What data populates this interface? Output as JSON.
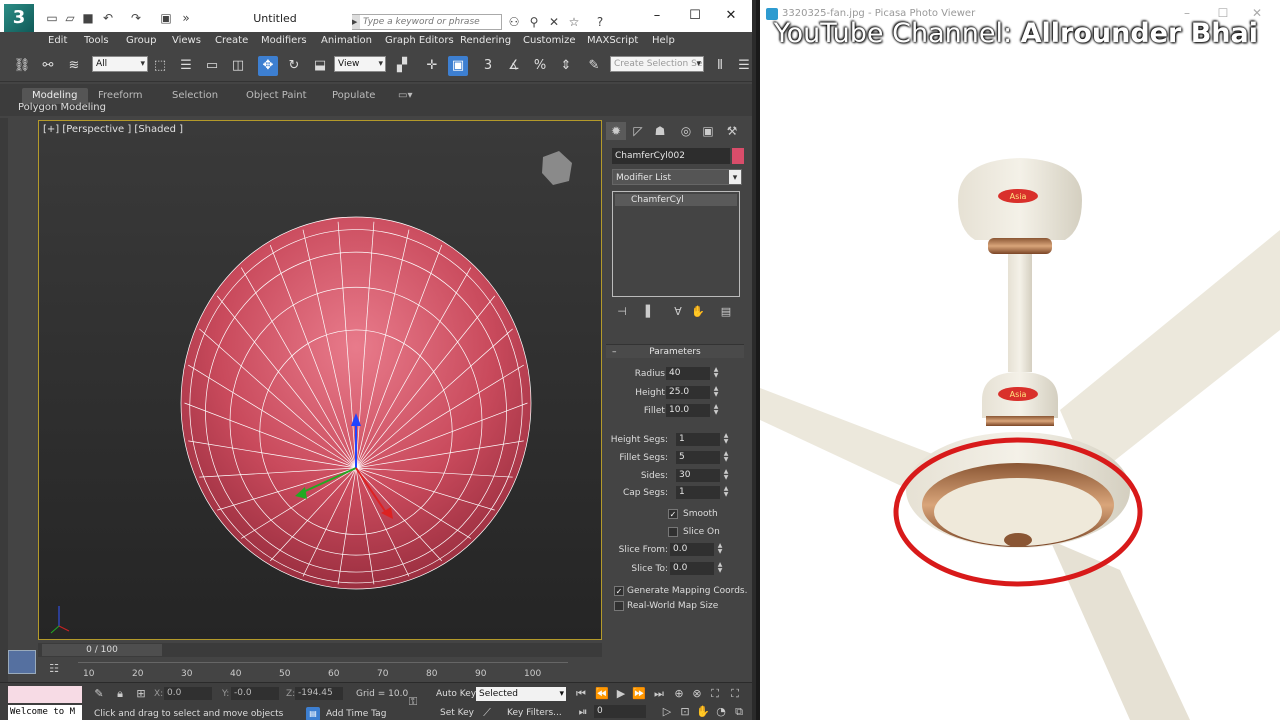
{
  "max": {
    "app_logo": "3",
    "doc_title": "Untitled",
    "search_placeholder": "Type a keyword or phrase",
    "menu": [
      "Edit",
      "Tools",
      "Group",
      "Views",
      "Create",
      "Modifiers",
      "Animation",
      "Graph Editors",
      "Rendering",
      "Customize",
      "MAXScript",
      "Help"
    ],
    "toolbar": {
      "filter_dd": "All",
      "refcoord_dd": "View",
      "named_sel_placeholder": "Create Selection Se"
    },
    "ribbon": {
      "tabs": [
        "Modeling",
        "Freeform",
        "Selection",
        "Object Paint",
        "Populate"
      ],
      "sub_label": "Polygon Modeling"
    },
    "viewport": {
      "label": "[+] [Perspective ] [Shaded ]"
    },
    "command_panel": {
      "object_name": "ChamferCyl002",
      "object_color": "#d94d6a",
      "modifier_list": "Modifier List",
      "stack_item": "ChamferCyl",
      "rollout_title": "Parameters",
      "params": {
        "radius_label": "Radius:",
        "radius": "40",
        "height_label": "Height:",
        "height": "25.0",
        "fillet_label": "Fillet:",
        "fillet": "10.0",
        "height_segs_label": "Height Segs:",
        "height_segs": "1",
        "fillet_segs_label": "Fillet Segs:",
        "fillet_segs": "5",
        "sides_label": "Sides:",
        "sides": "30",
        "cap_segs_label": "Cap Segs:",
        "cap_segs": "1",
        "smooth_label": "Smooth",
        "slice_on_label": "Slice On",
        "slice_from_label": "Slice From:",
        "slice_from": "0.0",
        "slice_to_label": "Slice To:",
        "slice_to": "0.0",
        "gen_mapping_label": "Generate Mapping Coords.",
        "real_world_label": "Real-World Map Size"
      },
      "checks": {
        "smooth": true,
        "slice_on": false,
        "gen_mapping": true,
        "real_world": false
      }
    },
    "timeline": {
      "frame_display": "0 / 100",
      "ticks": [
        "10",
        "20",
        "30",
        "40",
        "50",
        "60",
        "70",
        "80",
        "90",
        "100"
      ]
    },
    "status": {
      "welcome": "Welcome to M",
      "x_label": "X:",
      "x_value": "0.0",
      "y_label": "Y:",
      "y_value": "-0.0",
      "z_label": "Z:",
      "z_value": "-194.45",
      "grid": "Grid = 10.0",
      "auto_key": "Auto Key",
      "selected_dd": "Selected",
      "set_key": "Set Key",
      "key_filters": "Key Filters...",
      "frame": "0",
      "prompt": "Click and drag to select and move objects",
      "add_time_tag": "Add Time Tag"
    }
  },
  "picasa": {
    "title": "3320325-fan.jpg - Picasa Photo Viewer",
    "watermark_a": "YouTube Channel: ",
    "watermark_b": "Allrounder Bhai",
    "brand_top": "Asia",
    "brand_bottom": "Asia"
  }
}
